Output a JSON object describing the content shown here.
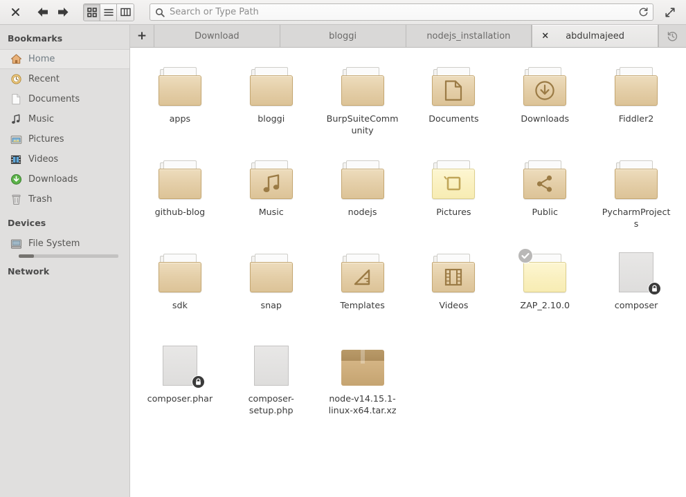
{
  "toolbar": {
    "close_label": "×",
    "back_icon": "back-arrow-icon",
    "forward_icon": "forward-arrow-icon",
    "view_modes": [
      {
        "name": "icon-view",
        "label": "Icon View",
        "active": true
      },
      {
        "name": "list-view",
        "label": "List View",
        "active": false
      },
      {
        "name": "column-view",
        "label": "Column View",
        "active": false
      }
    ],
    "search": {
      "value": "",
      "placeholder": "Search or Type Path"
    },
    "reload_icon": "reload-icon",
    "expand_icon": "expand-icon"
  },
  "sidebar": {
    "sections": [
      {
        "title": "Bookmarks",
        "items": [
          {
            "label": "Home",
            "icon": "home-icon",
            "selected": true
          },
          {
            "label": "Recent",
            "icon": "recent-clock-icon",
            "selected": false
          },
          {
            "label": "Documents",
            "icon": "document-icon",
            "selected": false
          },
          {
            "label": "Music",
            "icon": "music-note-icon",
            "selected": false
          },
          {
            "label": "Pictures",
            "icon": "pictures-icon",
            "selected": false
          },
          {
            "label": "Videos",
            "icon": "video-film-icon",
            "selected": false
          },
          {
            "label": "Downloads",
            "icon": "download-icon",
            "selected": false
          },
          {
            "label": "Trash",
            "icon": "trash-icon",
            "selected": false
          }
        ]
      },
      {
        "title": "Devices",
        "items": [
          {
            "label": "File System",
            "icon": "harddisk-icon",
            "selected": false,
            "usage_percent": 15
          }
        ]
      },
      {
        "title": "Network",
        "items": []
      }
    ]
  },
  "tabs": {
    "new_tab_label": "+",
    "history_icon": "history-icon",
    "items": [
      {
        "label": "Download",
        "active": false,
        "closable": false
      },
      {
        "label": "bloggi",
        "active": false,
        "closable": false
      },
      {
        "label": "nodejs_installation",
        "active": false,
        "closable": false
      },
      {
        "label": "abdulmajeed",
        "active": true,
        "closable": true,
        "close_label": "×"
      }
    ]
  },
  "files": [
    {
      "name": "apps",
      "type": "folder",
      "emblem": "none",
      "badge": "none"
    },
    {
      "name": "bloggi",
      "type": "folder",
      "emblem": "none",
      "badge": "none"
    },
    {
      "name": "BurpSuiteCommunity",
      "type": "folder",
      "emblem": "none",
      "badge": "none"
    },
    {
      "name": "Documents",
      "type": "folder",
      "emblem": "document-icon",
      "badge": "none"
    },
    {
      "name": "Downloads",
      "type": "folder",
      "emblem": "download-icon",
      "badge": "none"
    },
    {
      "name": "Fiddler2",
      "type": "folder",
      "emblem": "none",
      "badge": "none"
    },
    {
      "name": "github-blog",
      "type": "folder",
      "emblem": "none",
      "badge": "none"
    },
    {
      "name": "Music",
      "type": "folder",
      "emblem": "music-note-icon",
      "badge": "none"
    },
    {
      "name": "nodejs",
      "type": "folder",
      "emblem": "none",
      "badge": "none"
    },
    {
      "name": "Pictures",
      "type": "folder-light",
      "emblem": "pictures-icon",
      "badge": "none"
    },
    {
      "name": "Public",
      "type": "folder",
      "emblem": "share-icon",
      "badge": "none"
    },
    {
      "name": "PycharmProjects",
      "type": "folder",
      "emblem": "none",
      "badge": "none"
    },
    {
      "name": "sdk",
      "type": "folder",
      "emblem": "none",
      "badge": "none"
    },
    {
      "name": "snap",
      "type": "folder",
      "emblem": "none",
      "badge": "none"
    },
    {
      "name": "Templates",
      "type": "folder",
      "emblem": "template-ruler-icon",
      "badge": "none"
    },
    {
      "name": "Videos",
      "type": "folder",
      "emblem": "video-film-icon",
      "badge": "none"
    },
    {
      "name": "ZAP_2.10.0",
      "type": "folder-light",
      "emblem": "none",
      "badge": "check-badge-icon"
    },
    {
      "name": "composer",
      "type": "php-file",
      "emblem": "php-tag",
      "badge": "lock-badge-icon",
      "glyph": "<?>"
    },
    {
      "name": "composer.phar",
      "type": "php-file",
      "emblem": "php-tag",
      "badge": "lock-badge-icon",
      "glyph": "<?>"
    },
    {
      "name": "composer-setup.php",
      "type": "php-file",
      "emblem": "php-tag",
      "badge": "none",
      "glyph": "<?>"
    },
    {
      "name": "node-v14.15.1-linux-x64.tar.xz",
      "type": "archive",
      "emblem": "box-icon",
      "badge": "none"
    }
  ],
  "colors": {
    "folder_tan": "#e3cda6",
    "folder_light": "#faf0bf",
    "php_purple": "#7c4fa8",
    "sidebar_bg": "#e0dfde",
    "toolbar_bg": "#eeedec"
  }
}
